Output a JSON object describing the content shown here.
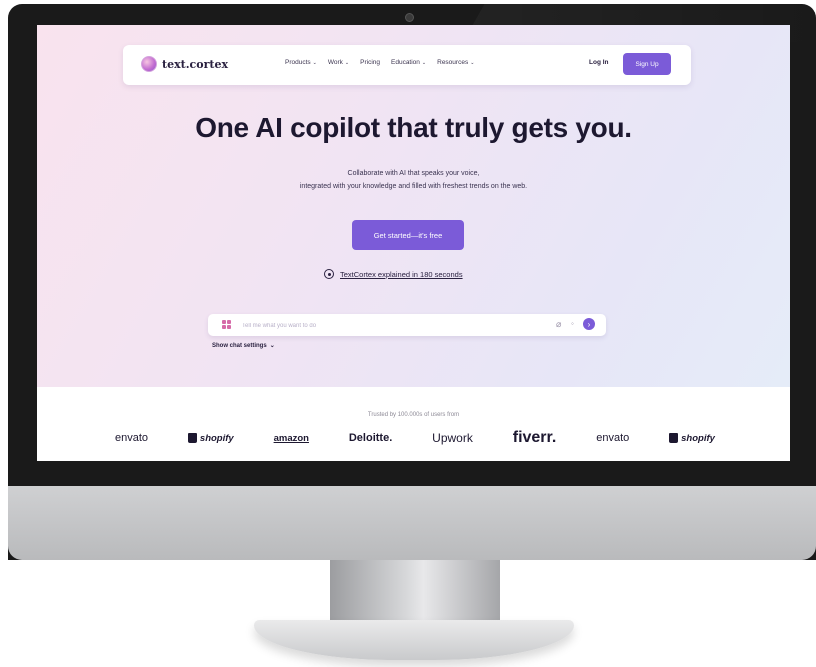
{
  "nav": {
    "logo": "text.cortex",
    "menu": [
      {
        "label": "Products",
        "dropdown": true
      },
      {
        "label": "Work",
        "dropdown": true
      },
      {
        "label": "Pricing",
        "dropdown": false
      },
      {
        "label": "Education",
        "dropdown": true
      },
      {
        "label": "Resources",
        "dropdown": true
      }
    ],
    "login": "Log In",
    "signup": "Sign Up"
  },
  "hero": {
    "headline": "One AI copilot that truly gets you.",
    "subline_1": "Collaborate with AI that speaks your voice,",
    "subline_2": "integrated with your knowledge and filled with freshest trends on the web.",
    "cta": "Get started—it's free",
    "video_link": "TextCortex explained in 180 seconds"
  },
  "chat": {
    "placeholder": "Tell me what you want to do",
    "settings": "Show chat settings"
  },
  "trust": {
    "label": "Trusted by 100.000s of users from",
    "brands": [
      "envato",
      "shopify",
      "amazon",
      "Deloitte.",
      "Upwork",
      "fiverr.",
      "envato",
      "shopify"
    ]
  },
  "colors": {
    "accent": "#7b5bd8",
    "text": "#1d1830"
  }
}
